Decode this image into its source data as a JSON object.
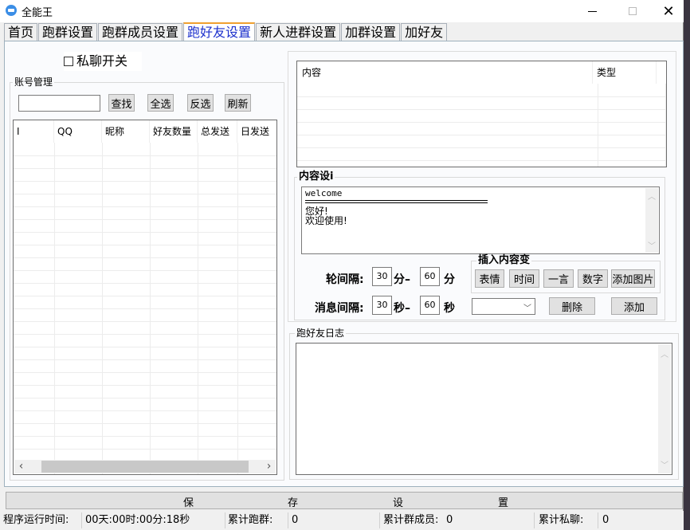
{
  "window": {
    "title": "全能王",
    "icon": "app-icon",
    "controls": {
      "minimize": "minimize-icon",
      "maximize": "maximize-icon",
      "close": "✕"
    }
  },
  "tabs": [
    {
      "label": "首页",
      "active": false
    },
    {
      "label": "跑群设置",
      "active": false
    },
    {
      "label": "跑群成员设置",
      "active": false
    },
    {
      "label": "跑好友设置",
      "active": true
    },
    {
      "label": "新人进群设置",
      "active": false
    },
    {
      "label": "加群设置",
      "active": false
    },
    {
      "label": "加好友",
      "active": false
    }
  ],
  "private_chat_toggle": {
    "label": "私聊开关",
    "checked": false
  },
  "account_mgmt": {
    "legend": "账号管理",
    "search_value": "",
    "buttons": {
      "search": "查找",
      "select_all": "全选",
      "invert": "反选",
      "refresh": "刷新"
    },
    "columns": [
      "I",
      "QQ",
      "昵称",
      "好友数量",
      "总发送",
      "日发送"
    ],
    "rows": [],
    "scroll": {
      "left": "‹",
      "right": "›"
    }
  },
  "content_list": {
    "columns": [
      "内容",
      "类型"
    ],
    "rows": []
  },
  "content_design": {
    "legend": "内容设i",
    "text_line1": "welcome",
    "text_line2": "您好!",
    "text_line3": "欢迎使用!"
  },
  "intervals": {
    "round_label": "轮间隔:",
    "round_min": "30",
    "round_sep": "分–",
    "round_max": "60",
    "round_unit": "分",
    "msg_label": "消息间隔:",
    "msg_min": "30",
    "msg_sep": "秒–",
    "msg_max": "60",
    "msg_unit": "秒"
  },
  "insert_vars": {
    "legend": "插入内容变",
    "buttons": [
      "表情",
      "时间",
      "一言",
      "数字",
      "添加图片"
    ]
  },
  "type_select": {
    "value": ""
  },
  "actions": {
    "delete": "删除",
    "add": "添加"
  },
  "log": {
    "legend": "跑好友日志",
    "content": ""
  },
  "save_button": {
    "chars": [
      "保",
      "存",
      "设",
      "置"
    ]
  },
  "status": {
    "runtime_label": "程序运行时间:",
    "runtime_value": "00天:00时:00分:18秒",
    "groups_label": "累计跑群:",
    "groups_value": "0",
    "members_label": "累计群成员:",
    "members_value": "0",
    "private_label": "累计私聊:",
    "private_value": "0"
  }
}
